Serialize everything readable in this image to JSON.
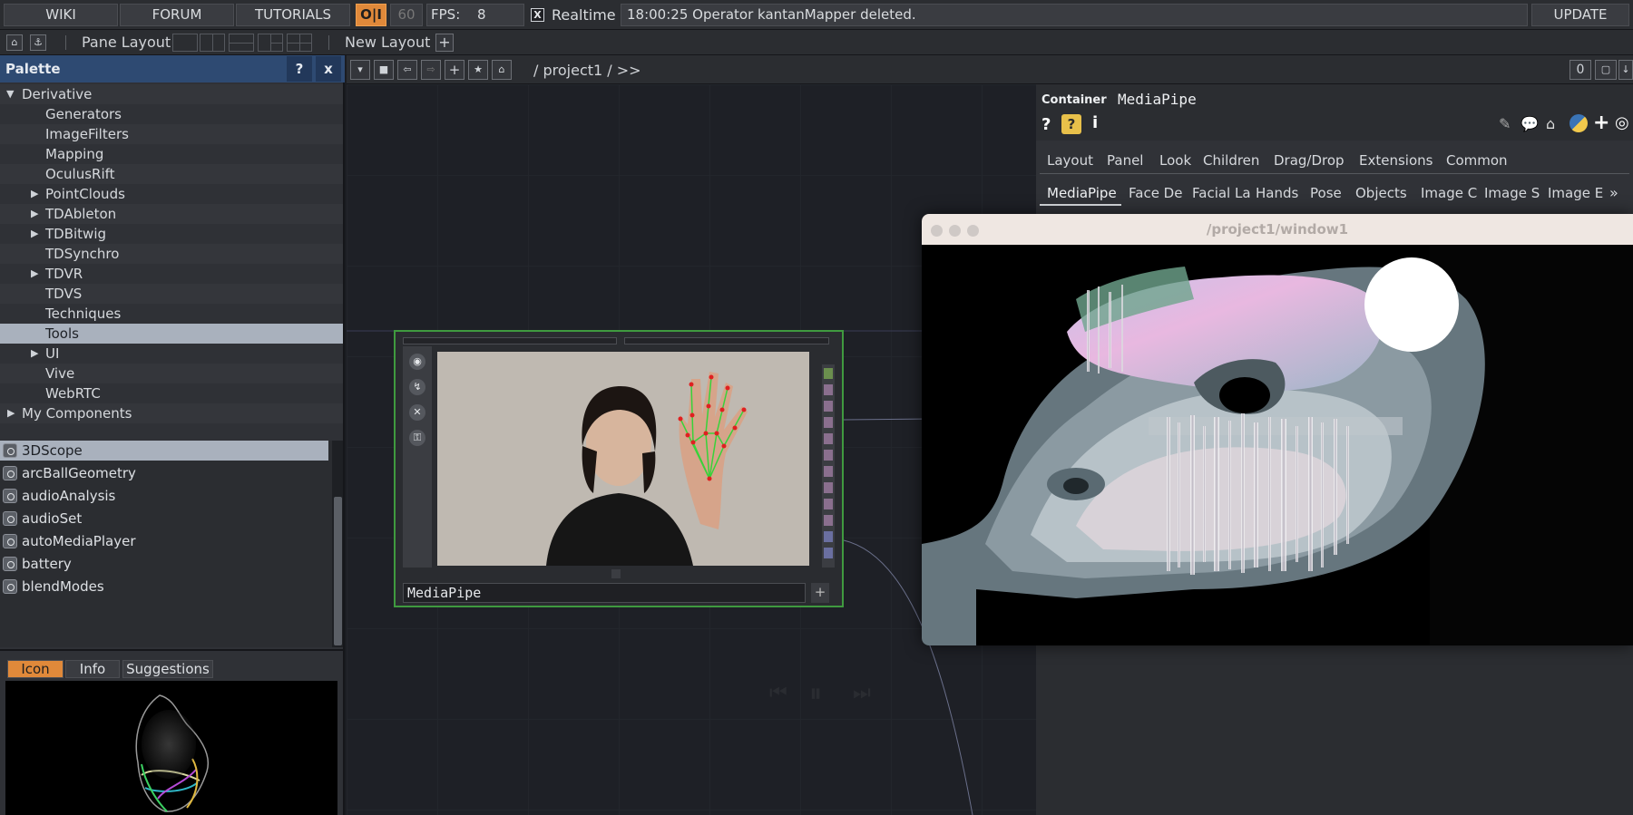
{
  "topbar": {
    "wiki": "WIKI",
    "forum": "FORUM",
    "tutorials": "TUTORIALS",
    "oi": "O|I",
    "frame_rate": "60",
    "fps_label": "FPS:",
    "fps_value": "8",
    "realtime_check": "X",
    "realtime_label": "Realtime",
    "message": "18:00:25 Operator kantanMapper deleted.",
    "update": "UPDATE"
  },
  "toolbar2": {
    "pane_layout": "Pane Layout",
    "new_layout": "New Layout",
    "new_layout_add": "+"
  },
  "palette": {
    "title": "Palette",
    "help": "?",
    "close": "x",
    "tree": [
      {
        "label": "Derivative",
        "expanded": true
      },
      {
        "label": "Generators"
      },
      {
        "label": "ImageFilters"
      },
      {
        "label": "Mapping"
      },
      {
        "label": "OculusRift"
      },
      {
        "label": "PointClouds",
        "collapsed": true
      },
      {
        "label": "TDAbleton",
        "collapsed": true
      },
      {
        "label": "TDBitwig",
        "collapsed": true
      },
      {
        "label": "TDSynchro"
      },
      {
        "label": "TDVR",
        "collapsed": true
      },
      {
        "label": "TDVS"
      },
      {
        "label": "Techniques"
      },
      {
        "label": "Tools",
        "selected": true
      },
      {
        "label": "UI",
        "collapsed": true
      },
      {
        "label": "Vive"
      },
      {
        "label": "WebRTC"
      },
      {
        "label": "My Components",
        "collapsed": true
      }
    ],
    "components": [
      "3DScope",
      "arcBallGeometry",
      "audioAnalysis",
      "audioSet",
      "autoMediaPlayer",
      "battery",
      "blendModes"
    ],
    "bottom_tabs": {
      "icon": "Icon",
      "info": "Info",
      "suggestions": "Suggestions"
    }
  },
  "network": {
    "path": "/ project1 / >>",
    "counter": "0",
    "node_label": "MediaPipe",
    "node_plus": "+"
  },
  "params": {
    "type_label": "Container",
    "name": "MediaPipe",
    "help1": "?",
    "info": "i",
    "tabs_row1": [
      "Layout",
      "Panel",
      "Look",
      "Children",
      "Drag/Drop",
      "Extensions",
      "Common"
    ],
    "tabs_row2": [
      "MediaPipe",
      "Face De",
      "Facial La",
      "Hands",
      "Pose",
      "Objects",
      "Image C",
      "Image S",
      "Image E"
    ],
    "more": "»"
  },
  "window": {
    "title": "/project1/window1"
  },
  "colors": {
    "accent_orange": "#e0893a",
    "palette_header": "#2e4a72",
    "node_border": "#3f9a3f",
    "selection": "#a9b1bd"
  }
}
